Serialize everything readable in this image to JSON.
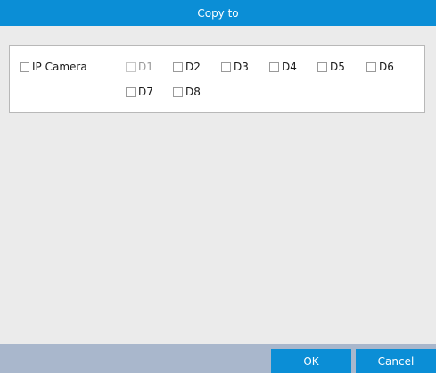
{
  "dialog": {
    "title": "Copy to"
  },
  "ip_camera": {
    "label": "IP Camera",
    "checked": false
  },
  "channels": [
    {
      "label": "D1",
      "checked": false,
      "enabled": false
    },
    {
      "label": "D2",
      "checked": false,
      "enabled": true
    },
    {
      "label": "D3",
      "checked": false,
      "enabled": true
    },
    {
      "label": "D4",
      "checked": false,
      "enabled": true
    },
    {
      "label": "D5",
      "checked": false,
      "enabled": true
    },
    {
      "label": "D6",
      "checked": false,
      "enabled": true
    },
    {
      "label": "D7",
      "checked": false,
      "enabled": true
    },
    {
      "label": "D8",
      "checked": false,
      "enabled": true
    }
  ],
  "buttons": {
    "ok": "OK",
    "cancel": "Cancel"
  },
  "colors": {
    "title_bar": "#0b8ed6",
    "footer": "#a9b7cc",
    "button": "#0b8ed6",
    "background": "#ebebeb"
  }
}
